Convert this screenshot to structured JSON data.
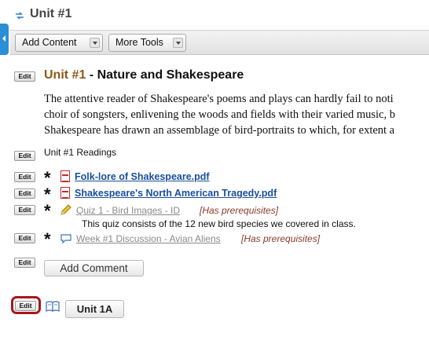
{
  "header": {
    "title": "Unit #1"
  },
  "toolbar": {
    "add_content": "Add Content",
    "more_tools": "More Tools"
  },
  "edit_label": "Edit",
  "module": {
    "heading_number": "Unit #1",
    "heading_rest": " - Nature and Shakespeare",
    "description_lines": [
      "The attentive reader of Shakespeare's poems and plays can hardly fail to noti",
      "choir of songsters, enlivening the woods and fields with their varied music, b",
      "Shakespeare has drawn an assemblage of bird-portraits to which, for extent a"
    ]
  },
  "readings_label": "Unit #1 Readings",
  "items": [
    {
      "type": "pdf",
      "marker": "*",
      "title": "Folk-lore of Shakespeare.pdf",
      "icon": "pdf-icon"
    },
    {
      "type": "pdf",
      "marker": "*",
      "title": "Shakespeare's North American Tragedy.pdf",
      "icon": "pdf-icon"
    },
    {
      "type": "quiz",
      "marker": "*",
      "title": "Quiz 1 - Bird Images - ID",
      "status": "[Has prerequisites]",
      "description": "This quiz consists of the 12 new bird species we covered in class.",
      "icon": "pencil-icon"
    },
    {
      "type": "discussion",
      "marker": "*",
      "title": "Week #1 Discussion - Avian Aliens",
      "status": "[Has prerequisites]",
      "icon": "speech-bubble-icon"
    }
  ],
  "add_comment": "Add Comment",
  "sub_unit": {
    "label": "Unit 1A",
    "icon": "book-icon"
  },
  "colors": {
    "accent_tab": "#2a8fd6",
    "link": "#1a4f9c",
    "heading_number": "#8a5a16",
    "prerequisite": "#8a3a2a",
    "highlight": "#a31919"
  }
}
